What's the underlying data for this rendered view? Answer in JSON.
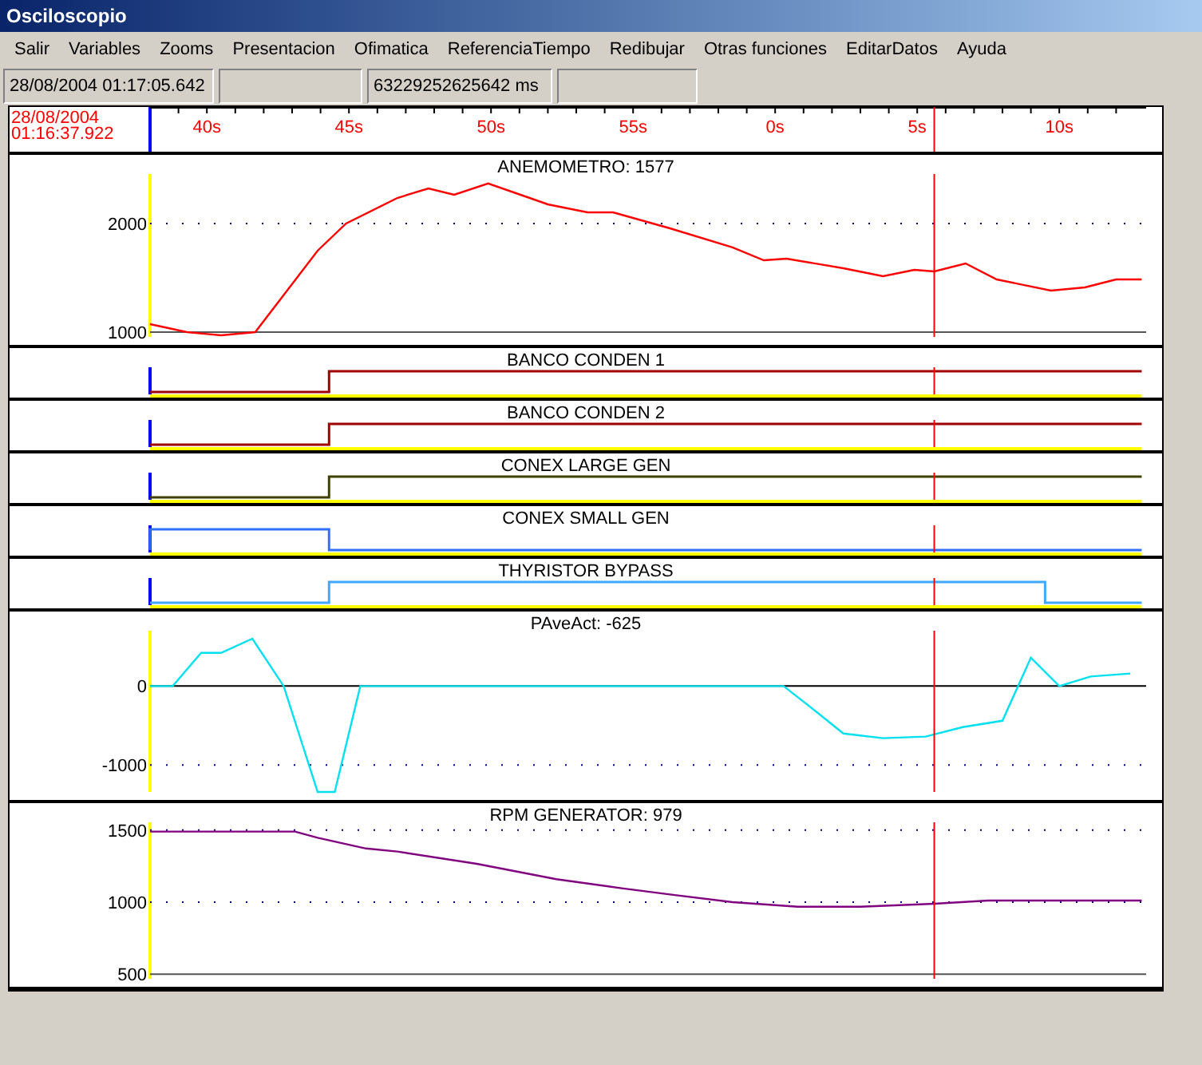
{
  "window": {
    "title": "Osciloscopio"
  },
  "menu": [
    "Salir",
    "Variables",
    "Zooms",
    "Presentacion",
    "Ofimatica",
    "ReferenciaTiempo",
    "Redibujar",
    "Otras funciones",
    "EditarDatos",
    "Ayuda"
  ],
  "status_fields": [
    "28/08/2004 01:17:05.642",
    "63229252625642 ms"
  ],
  "time_ruler": {
    "start_date": "28/08/2004",
    "start_time": "01:16:37.922",
    "labels": [
      "40s",
      "45s",
      "50s",
      "55s",
      "0s",
      "5s",
      "10s"
    ]
  },
  "panels": [
    {
      "kind": "analog",
      "title": "ANEMOMETRO: 1577",
      "color": "#ff0000",
      "y_labels": [
        "2000",
        "1000"
      ]
    },
    {
      "kind": "rising",
      "title": "BANCO CONDEN 1",
      "color": "#a00000"
    },
    {
      "kind": "rising",
      "title": "BANCO CONDEN 2",
      "color": "#a00000"
    },
    {
      "kind": "rising",
      "title": "CONEX LARGE GEN",
      "color": "#404000"
    },
    {
      "kind": "falling",
      "title": "CONEX SMALL GEN",
      "color": "#3070ff"
    },
    {
      "kind": "pulse",
      "title": "THYRISTOR BYPASS",
      "color": "#40a8ff"
    },
    {
      "kind": "analog",
      "title": "PAveAct: -625",
      "color": "#00e0f0",
      "y_labels": [
        "0",
        "-1000"
      ]
    },
    {
      "kind": "analog",
      "title": "RPM GENERATOR: 979",
      "color": "#800080",
      "y_labels": [
        "1500",
        "1000",
        "500"
      ]
    }
  ]
}
